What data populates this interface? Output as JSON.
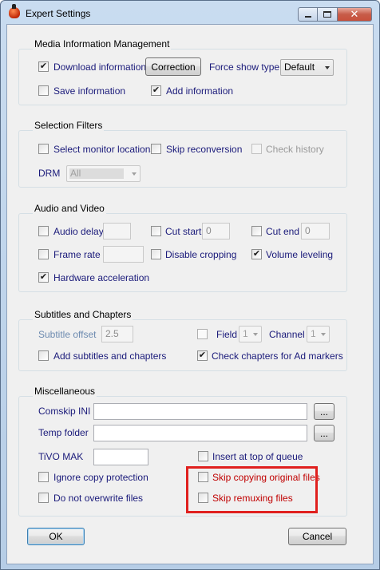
{
  "window": {
    "title": "Expert Settings"
  },
  "media": {
    "title": "Media Information Management",
    "download_label": "Download information",
    "correction_label": "Correction",
    "force_show_type_label": "Force show type",
    "force_show_type_value": "Default",
    "save_label": "Save information",
    "add_label": "Add information"
  },
  "selection": {
    "title": "Selection Filters",
    "select_monitor_label": "Select monitor locations",
    "skip_reconversion_label": "Skip reconversion",
    "check_history_label": "Check history",
    "drm_label": "DRM",
    "drm_value": "All"
  },
  "av": {
    "title": "Audio and Video",
    "audio_delay_label": "Audio delay",
    "cut_start_label": "Cut start",
    "cut_start_value": "0",
    "cut_end_label": "Cut end",
    "cut_end_value": "0",
    "frame_rate_label": "Frame rate",
    "disable_cropping_label": "Disable cropping",
    "volume_leveling_label": "Volume leveling",
    "hardware_accel_label": "Hardware acceleration"
  },
  "subs": {
    "title": "Subtitles and Chapters",
    "offset_label": "Subtitle offset",
    "offset_value": "2.5",
    "field_label": "Field",
    "field_value": "1",
    "channel_label": "Channel",
    "channel_value": "1",
    "add_subs_label": "Add subtitles and chapters",
    "check_chapters_label": "Check chapters for Ad markers"
  },
  "misc": {
    "title": "Miscellaneous",
    "comskip_label": "Comskip INI",
    "comskip_value": "",
    "browse_label": "...",
    "temp_label": "Temp folder",
    "temp_value": "",
    "tivo_mak_label": "TiVO MAK",
    "tivo_mak_value": "",
    "insert_top_label": "Insert at top of queue",
    "ignore_copy_label": "Ignore copy protection",
    "skip_copying_label": "Skip copying original files",
    "no_overwrite_label": "Do not overwrite files",
    "skip_remuxing_label": "Skip remuxing files"
  },
  "buttons": {
    "ok": "OK",
    "cancel": "Cancel"
  },
  "checks": {
    "download": true,
    "save": false,
    "add": true,
    "select_monitor": false,
    "skip_reconversion": false,
    "check_history": false,
    "audio_delay": false,
    "cut_start": false,
    "cut_end": false,
    "frame_rate": false,
    "disable_cropping": false,
    "volume_leveling": true,
    "hardware_accel": true,
    "field": false,
    "add_subs": false,
    "check_chapters": true,
    "insert_top": false,
    "ignore_copy": false,
    "skip_copying": false,
    "no_overwrite": false,
    "skip_remuxing": false
  },
  "colors": {
    "label_navy": "#1a1a7a",
    "highlight_red": "#e0201e",
    "red_label": "#c00000"
  }
}
